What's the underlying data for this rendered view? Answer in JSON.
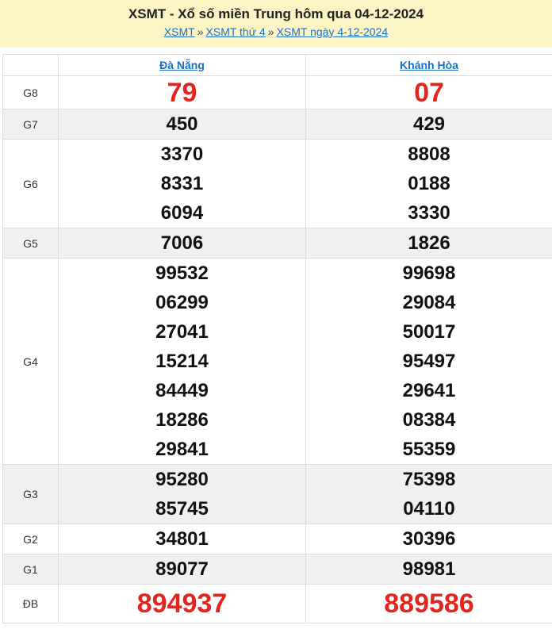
{
  "header": {
    "title": "XSMT - Xổ số miền Trung hôm qua 04-12-2024",
    "breadcrumb": [
      "XSMT",
      "XSMT thứ 4",
      "XSMT ngày 4-12-2024"
    ],
    "separator": "»"
  },
  "provinces": [
    "Đà Nẵng",
    "Khánh Hòa"
  ],
  "rows": [
    {
      "label": "G8",
      "a": [
        "79"
      ],
      "b": [
        "07"
      ]
    },
    {
      "label": "G7",
      "a": [
        "450"
      ],
      "b": [
        "429"
      ]
    },
    {
      "label": "G6",
      "a": [
        "3370",
        "8331",
        "6094"
      ],
      "b": [
        "8808",
        "0188",
        "3330"
      ]
    },
    {
      "label": "G5",
      "a": [
        "7006"
      ],
      "b": [
        "1826"
      ]
    },
    {
      "label": "G4",
      "a": [
        "99532",
        "06299",
        "27041",
        "15214",
        "84449",
        "18286",
        "29841"
      ],
      "b": [
        "99698",
        "29084",
        "50017",
        "95497",
        "29641",
        "08384",
        "55359"
      ]
    },
    {
      "label": "G3",
      "a": [
        "95280",
        "85745"
      ],
      "b": [
        "75398",
        "04110"
      ]
    },
    {
      "label": "G2",
      "a": [
        "34801"
      ],
      "b": [
        "30396"
      ]
    },
    {
      "label": "G1",
      "a": [
        "89077"
      ],
      "b": [
        "98981"
      ]
    },
    {
      "label": "ĐB",
      "a": [
        "894937"
      ],
      "b": [
        "889586"
      ]
    }
  ],
  "colors": {
    "header_bg": "#fdf4c6",
    "highlight_red": "#e0261e",
    "link": "#1a6fc4",
    "alt_row": "#f0f0f0"
  }
}
